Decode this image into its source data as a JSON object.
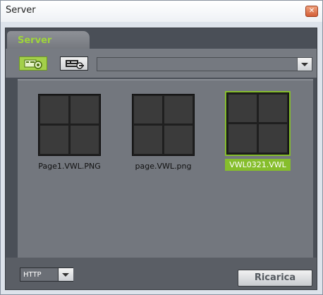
{
  "window": {
    "title": "Server",
    "close_glyph": "✕"
  },
  "tab": {
    "label": "Server"
  },
  "toolbar": {
    "buttons": [
      {
        "icon": "camera-view-icon",
        "active": true
      },
      {
        "icon": "film-projector-icon",
        "active": false
      }
    ],
    "path_combo_value": ""
  },
  "files": [
    {
      "name": "Page1.VWL.PNG",
      "selected": false
    },
    {
      "name": "page.VWL.png",
      "selected": false
    },
    {
      "name": "VWL0321.VWL",
      "selected": true
    }
  ],
  "bottom": {
    "protocol": "HTTP",
    "reload_label": "Ricarica"
  },
  "colors": {
    "accent": "#86be2c",
    "tab_text": "#9fd53a",
    "panel": "#4a4f57",
    "content": "#73777e"
  }
}
